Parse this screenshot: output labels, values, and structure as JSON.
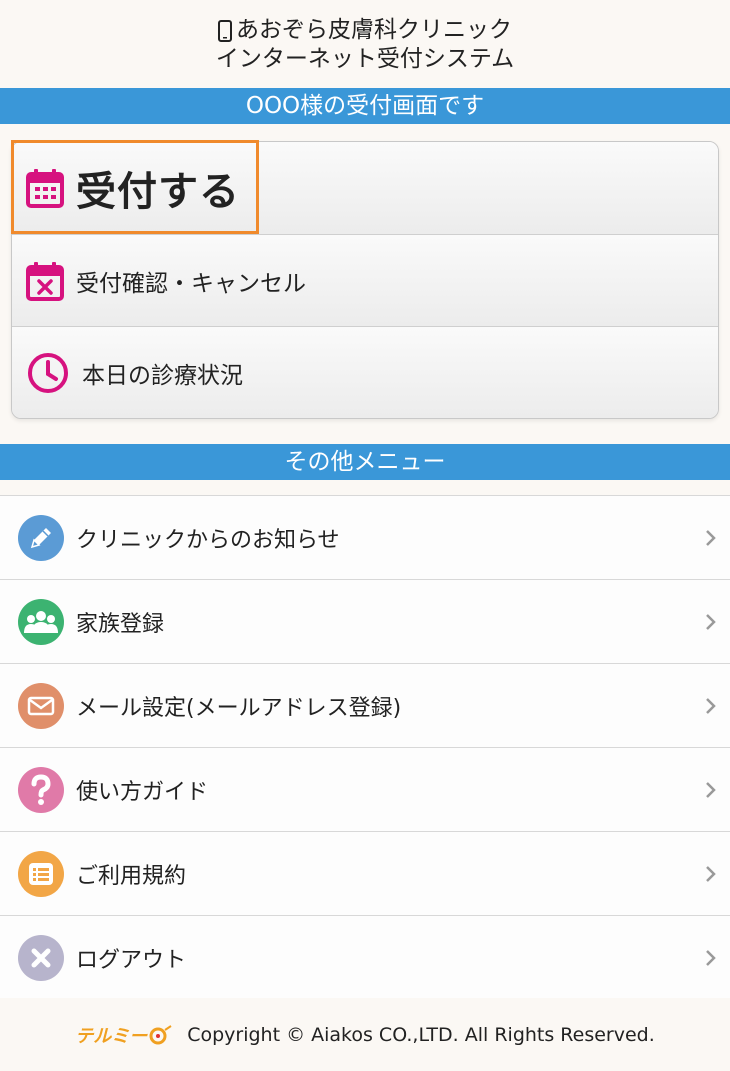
{
  "header": {
    "title_line1": "あおぞら皮膚科クリニック",
    "title_line2": "インターネット受付システム"
  },
  "welcome_bar": "OOO様の受付画面です",
  "main_menu": {
    "reception": "受付する",
    "confirm_cancel": "受付確認・キャンセル",
    "today_status": "本日の診療状況"
  },
  "other_bar": "その他メニュー",
  "other_menu": [
    {
      "label": "クリニックからのお知らせ",
      "icon": "pencil-icon",
      "color": "#5b9bd5"
    },
    {
      "label": "家族登録",
      "icon": "family-icon",
      "color": "#3cb371"
    },
    {
      "label": "メール設定(メールアドレス登録)",
      "icon": "mail-icon",
      "color": "#e08f6a"
    },
    {
      "label": "使い方ガイド",
      "icon": "question-icon",
      "color": "#e07aa8"
    },
    {
      "label": "ご利用規約",
      "icon": "list-icon",
      "color": "#f2a646"
    },
    {
      "label": "ログアウト",
      "icon": "logout-icon",
      "color": "#b7b4cc"
    }
  ],
  "footer": {
    "logo_text": "テルミー",
    "copyright": "Copyright © Aiakos CO.,LTD. All Rights Reserved."
  },
  "colors": {
    "accent_bar": "#3a97d8",
    "icon_magenta": "#d6127f",
    "highlight": "#f08a2c"
  }
}
